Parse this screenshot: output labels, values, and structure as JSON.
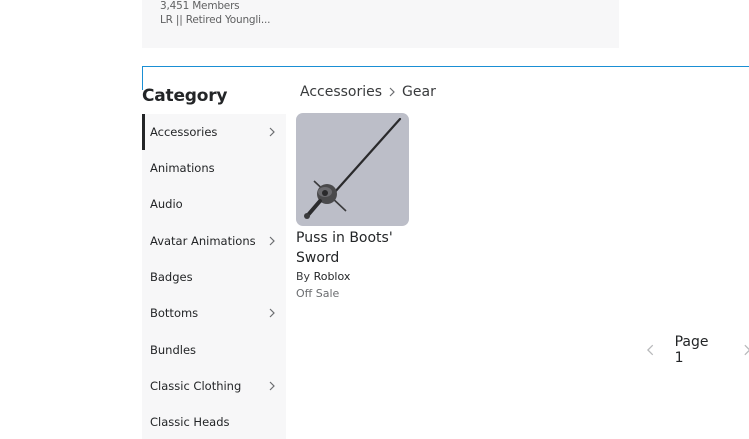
{
  "group": {
    "members": "3,451 Members",
    "owner": "LR || Retired Youngli..."
  },
  "category": {
    "title": "Category",
    "items": [
      {
        "label": "Accessories",
        "has_children": true,
        "active": true
      },
      {
        "label": "Animations",
        "has_children": false
      },
      {
        "label": "Audio",
        "has_children": false
      },
      {
        "label": "Avatar Animations",
        "has_children": true
      },
      {
        "label": "Badges",
        "has_children": false
      },
      {
        "label": "Bottoms",
        "has_children": true
      },
      {
        "label": "Bundles",
        "has_children": false
      },
      {
        "label": "Classic Clothing",
        "has_children": true
      },
      {
        "label": "Classic Heads",
        "has_children": false
      }
    ]
  },
  "breadcrumb": {
    "parent": "Accessories",
    "current": "Gear"
  },
  "item": {
    "name": "Puss in Boots' Sword",
    "by_label": "By",
    "creator": "Roblox",
    "price": "Off Sale",
    "icon": "sword-thumbnail"
  },
  "pager": {
    "label": "Page 1"
  },
  "colors": {
    "accent": "#1a8fd4",
    "panel": "#f7f7f8",
    "thumb_bg": "#bcbec8"
  }
}
